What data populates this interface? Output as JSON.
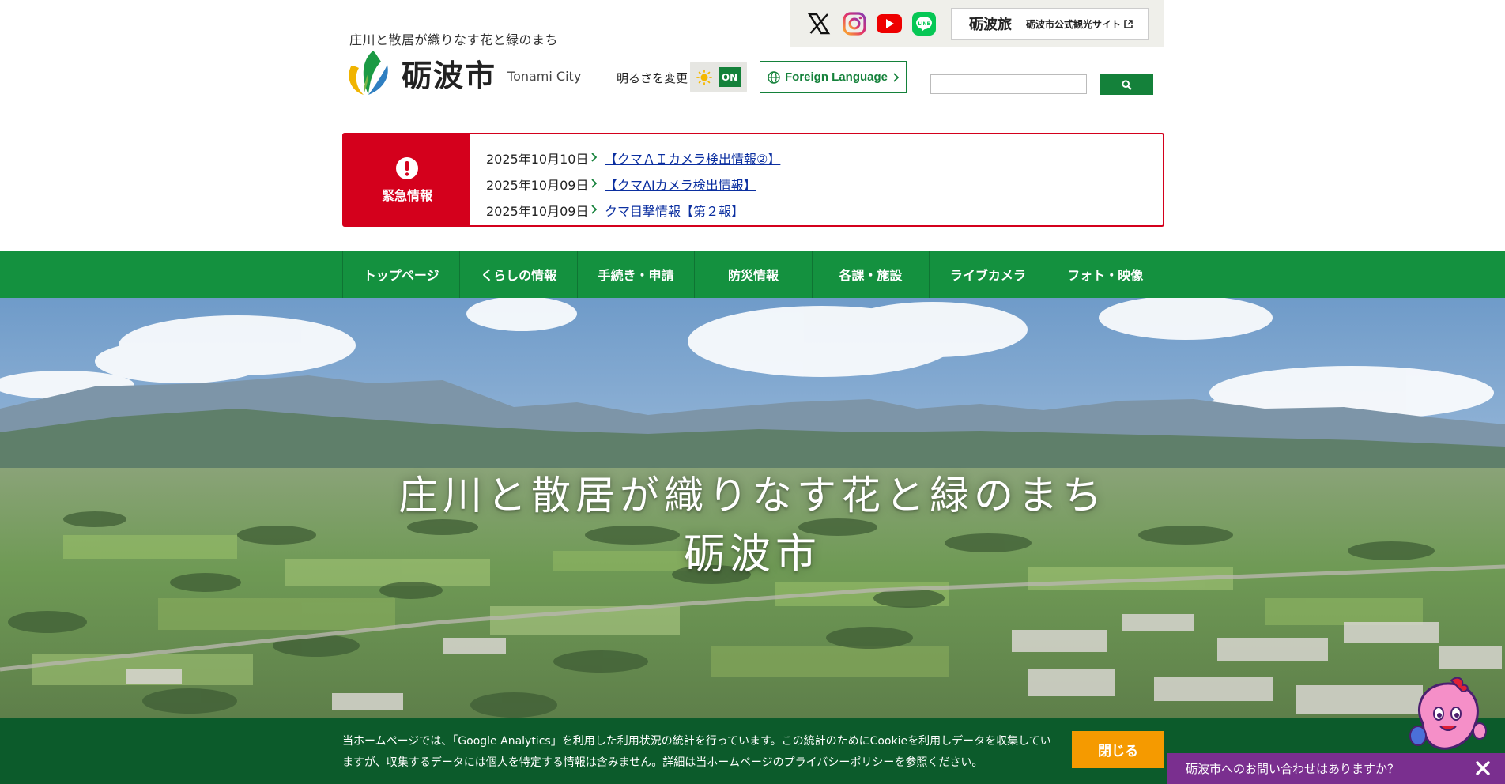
{
  "header": {
    "tagline": "庄川と散居が織りなす花と緑のまち",
    "logo_kanji": "砺波市",
    "logo_en": "Tonami City",
    "brightness_label": "明るさを変更",
    "brightness_state": "ON",
    "language_button": "Foreign Language",
    "search": {
      "placeholder": "",
      "value": ""
    }
  },
  "social": {
    "icons": [
      "x-icon",
      "instagram-icon",
      "youtube-icon",
      "line-icon"
    ],
    "tour_logo": "砺波旅",
    "tour_text": "砺波市公式観光サイト"
  },
  "emergency": {
    "label": "緊急情報",
    "items": [
      {
        "date": "2025年10月10日",
        "title": "【クマＡＩカメラ検出情報②】"
      },
      {
        "date": "2025年10月09日",
        "title": "【クマAIカメラ検出情報】"
      },
      {
        "date": "2025年10月09日",
        "title": "クマ目撃情報【第２報】"
      }
    ]
  },
  "nav": {
    "items": [
      "トップページ",
      "くらしの情報",
      "手続き・申請",
      "防災情報",
      "各課・施設",
      "ライブカメラ",
      "フォト・映像"
    ]
  },
  "hero": {
    "line1": "庄川と散居が織りなす花と緑のまち",
    "line2": "砺波市"
  },
  "cookie": {
    "text_before": "当ホームページでは、「Google Analytics」を利用した利用状況の統計を行っています。この統計のためにCookieを利用しデータを収集していますが、収集するデータには個人を特定する情報は含みません。詳細は当ホームページの",
    "link": "プライバシーポリシー",
    "text_after": "を参照ください。",
    "close_label": "閉じる"
  },
  "chat": {
    "label": "砺波市へのお問い合わせはありますか？"
  },
  "colors": {
    "brand_green": "#14913f",
    "dark_green": "#0c5b2b",
    "alert_red": "#d4001c",
    "accent_orange": "#f59a00",
    "chat_purple": "#7a2f8f"
  }
}
